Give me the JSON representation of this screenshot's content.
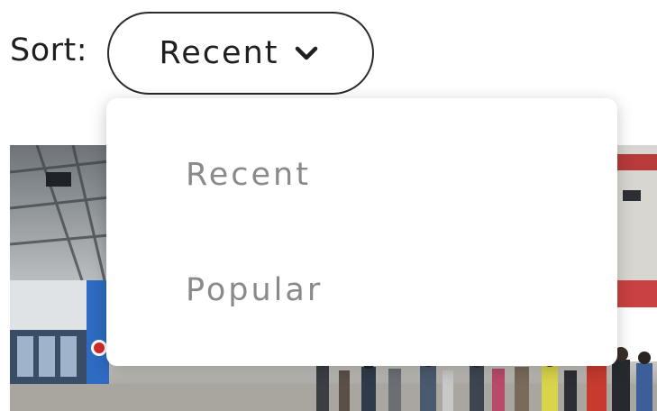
{
  "sort": {
    "label": "Sort:",
    "selected": "Recent",
    "options": [
      "Recent",
      "Popular"
    ]
  },
  "icons": {
    "dropdown": "chevron-down-icon"
  }
}
